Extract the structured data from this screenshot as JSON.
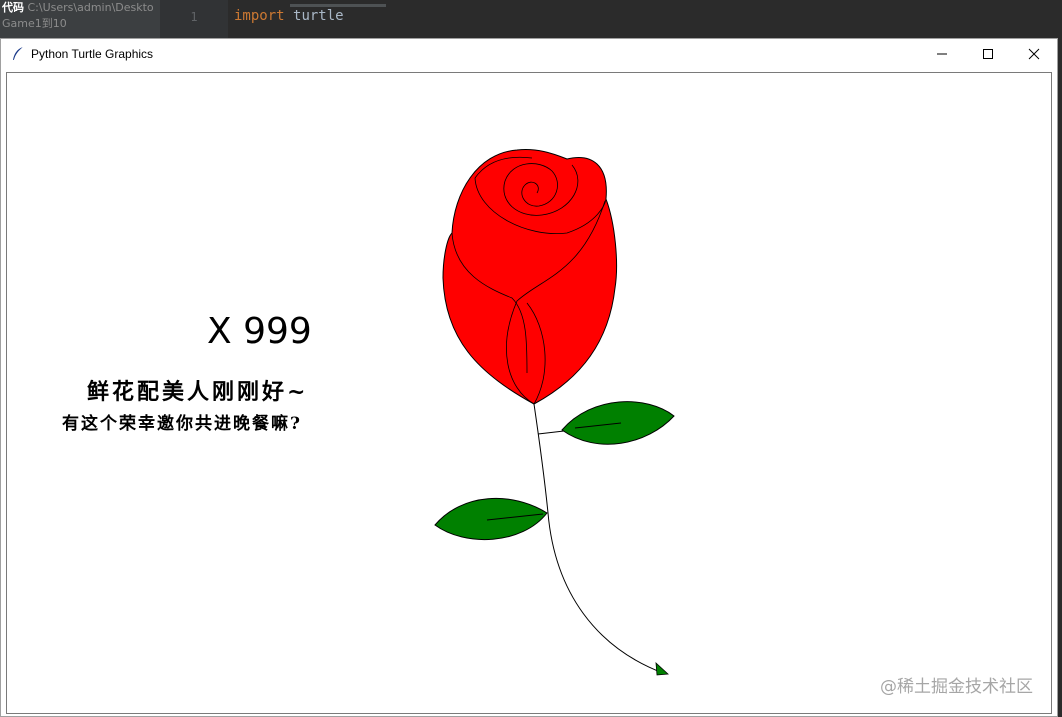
{
  "ide": {
    "panel_title": "代码",
    "path": "C:\\Users\\admin\\Deskto",
    "file_hint": "Game1到10",
    "line_number": "1",
    "code_keyword": "import",
    "code_module": "turtle"
  },
  "window": {
    "title": "Python Turtle Graphics",
    "controls": {
      "minimize_icon": "minimize-icon",
      "maximize_icon": "maximize-icon",
      "close_icon": "close-icon"
    }
  },
  "canvas": {
    "headline": "X 999",
    "line1": "鲜花配美人刚刚好~",
    "line2": "有这个荣幸邀你共进晚餐嘛?",
    "watermark": "@稀土掘金技术社区",
    "colors": {
      "petal": "#ff0000",
      "leaf": "#008000",
      "stroke": "#000000",
      "background": "#ffffff"
    }
  }
}
